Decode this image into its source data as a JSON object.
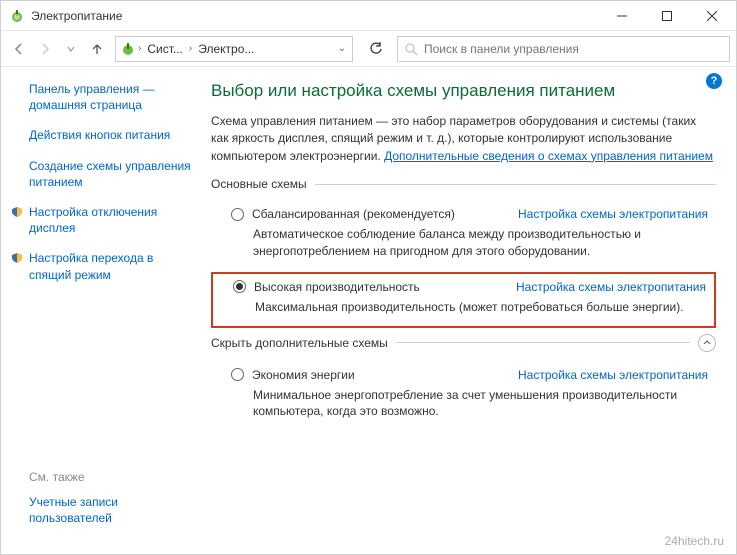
{
  "window": {
    "title": "Электропитание"
  },
  "breadcrumb": {
    "seg1": "Сист...",
    "seg2": "Электро..."
  },
  "search": {
    "placeholder": "Поиск в панели управления"
  },
  "sidebar": {
    "home": "Панель управления — домашняя страница",
    "buttons_action": "Действия кнопок питания",
    "create_plan": "Создание схемы управления питанием",
    "display_off": "Настройка отключения дисплея",
    "sleep": "Настройка перехода в спящий режим",
    "see_also": "См. также",
    "user_accounts": "Учетные записи пользователей"
  },
  "main": {
    "title": "Выбор или настройка схемы управления питанием",
    "desc_pre": "Схема управления питанием — это набор параметров оборудования и системы (таких как яркость дисплея, спящий режим и т. д.), которые контролируют использование компьютером электроэнергии. ",
    "desc_link": "Дополнительные сведения о схемах управления питанием",
    "section_main": "Основные схемы",
    "section_extra": "Скрыть дополнительные схемы",
    "plans": {
      "balanced": {
        "name": "Сбалансированная (рекомендуется)",
        "link": "Настройка схемы электропитания",
        "desc": "Автоматическое соблюдение баланса между производительностью и энергопотреблением на пригодном для этого оборудовании."
      },
      "high": {
        "name": "Высокая производительность",
        "link": "Настройка схемы электропитания",
        "desc": "Максимальная производительность (может потребоваться больше энергии)."
      },
      "saver": {
        "name": "Экономия энергии",
        "link": "Настройка схемы электропитания",
        "desc": "Минимальное энергопотребление за счет уменьшения производительности компьютера, когда это возможно."
      }
    }
  },
  "watermark": "24hitech.ru"
}
